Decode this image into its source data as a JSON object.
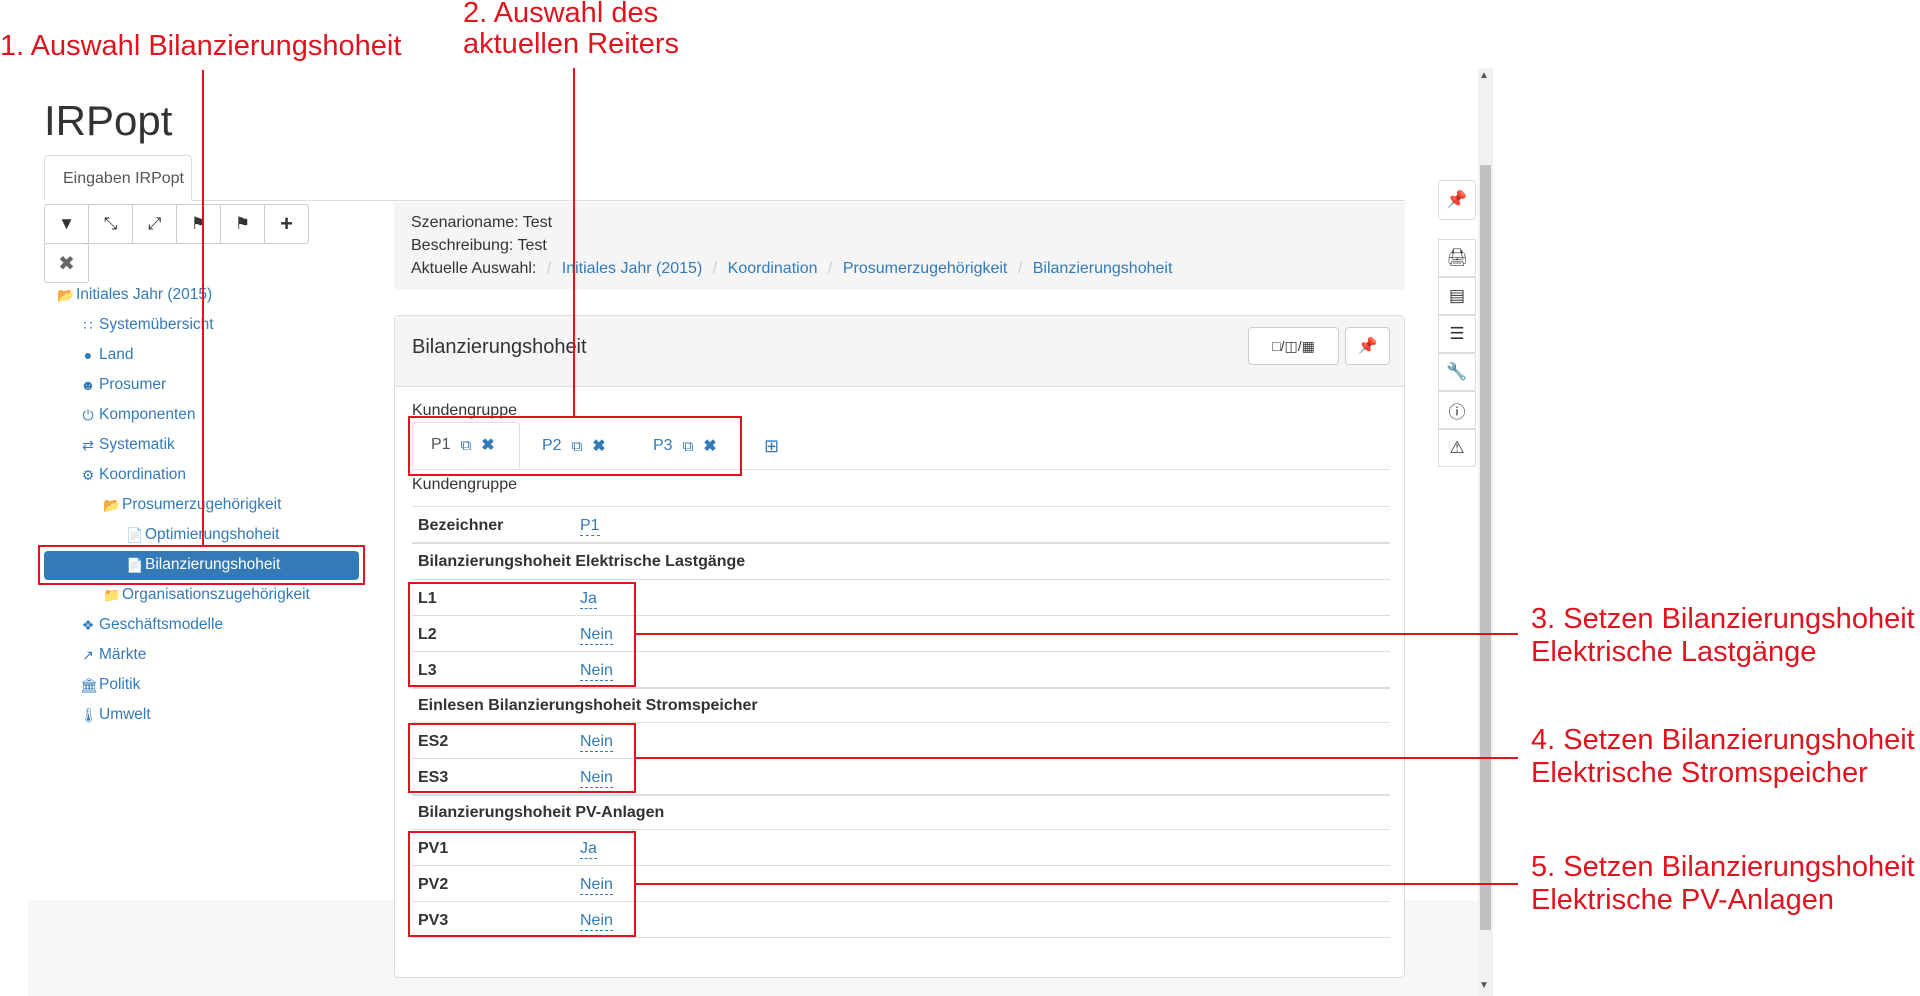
{
  "annotations": {
    "a1": "1. Auswahl Bilanzierungshoheit",
    "a2_line1": "2. Auswahl des",
    "a2_line2": "aktuellen Reiters",
    "a3_line1": "3. Setzen Bilanzierungshoheit",
    "a3_line2": "Elektrische Lastgänge",
    "a4_line1": "4. Setzen Bilanzierungshoheit",
    "a4_line2": "Elektrische Stromspeicher",
    "a5_line1": "5. Setzen Bilanzierungshoheit",
    "a5_line2": "Elektrische PV-Anlagen"
  },
  "app": {
    "title": "IRPopt",
    "tab": "Eingaben IRPopt"
  },
  "toolbar": {
    "icons": [
      "filter-icon",
      "expand-icon",
      "collapse-icon",
      "flag-import-icon",
      "flag-export-icon",
      "plus-icon",
      "close-icon"
    ]
  },
  "tree": {
    "root": "Initiales Jahr (2015)",
    "items": [
      "Systemübersicht",
      "Land",
      "Prosumer",
      "Komponenten",
      "Systematik",
      "Koordination",
      "Prosumerzugehörigkeit",
      "Optimierungshoheit",
      "Bilanzierungshoheit",
      "Organisationszugehörigkeit",
      "Geschäftsmodelle",
      "Märkte",
      "Politik",
      "Umwelt"
    ]
  },
  "scenario": {
    "name_line": "Szenarioname: Test",
    "desc_line": "Beschreibung: Test",
    "selection_label": "Aktuelle Auswahl:",
    "breadcrumbs": [
      "Initiales Jahr (2015)",
      "Koordination",
      "Prosumerzugehörigkeit",
      "Bilanzierungshoheit"
    ]
  },
  "panel": {
    "title": "Bilanzierungshoheit",
    "group_label": "Kundengruppe",
    "tabs": [
      "P1",
      "P2",
      "P3"
    ],
    "subheading": "Kundengruppe",
    "bezeichner_label": "Bezeichner",
    "bezeichner_value": "P1",
    "section1": "Bilanzierungshoheit Elektrische Lastgänge",
    "rows1": [
      {
        "label": "L1",
        "value": "Ja"
      },
      {
        "label": "L2",
        "value": "Nein"
      },
      {
        "label": "L3",
        "value": "Nein"
      }
    ],
    "section2": "Einlesen Bilanzierungshoheit Stromspeicher",
    "rows2": [
      {
        "label": "ES2",
        "value": "Nein"
      },
      {
        "label": "ES3",
        "value": "Nein"
      }
    ],
    "section3": "Bilanzierungshoheit PV-Anlagen",
    "rows3": [
      {
        "label": "PV1",
        "value": "Ja"
      },
      {
        "label": "PV2",
        "value": "Nein"
      },
      {
        "label": "PV3",
        "value": "Nein"
      }
    ]
  },
  "colors": {
    "accent": "#337ab7",
    "annotation_red": "#e0141e"
  }
}
